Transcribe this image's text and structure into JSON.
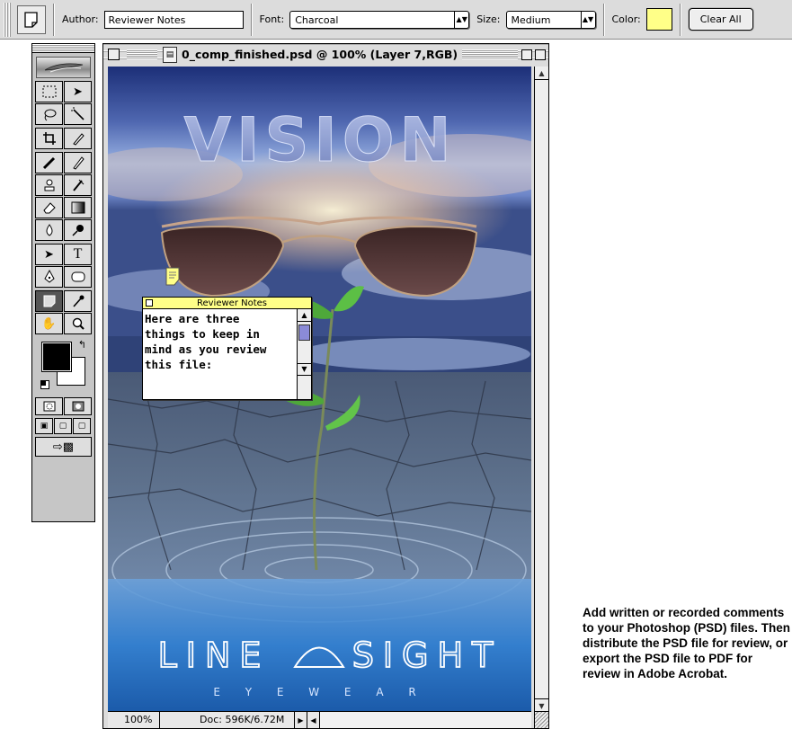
{
  "options_bar": {
    "author_label": "Author:",
    "author_value": "Reviewer Notes",
    "font_label": "Font:",
    "font_value": "Charcoal",
    "size_label": "Size:",
    "size_value": "Medium",
    "color_label": "Color:",
    "note_color": "#ffff88",
    "clear_all_label": "Clear All"
  },
  "document": {
    "title": "0_comp_finished.psd @ 100% (Layer 7,RGB)",
    "zoom": "100%",
    "doc_size": "Doc: 596K/6.72M",
    "artwork": {
      "headline": "VISION",
      "brand": "LINE",
      "brand2": "SIGHT",
      "tagline": "E  Y  E  W  E  A  R"
    }
  },
  "note": {
    "title": "Reviewer Notes",
    "body": "Here are three\nthings to keep in\nmind as you review\nthis file:"
  },
  "caption": "Add written or recorded comments to your Photoshop (PSD) files. Then distribute the PSD file for review, or export the PSD file to PDF for review in Adobe Acrobat.",
  "toolbox": {
    "tools": [
      "marquee-tool",
      "move-tool",
      "lasso-tool",
      "magic-wand-tool",
      "crop-tool",
      "slice-tool",
      "healing-brush-tool",
      "brush-tool",
      "clone-stamp-tool",
      "history-brush-tool",
      "eraser-tool",
      "gradient-tool",
      "blur-tool",
      "dodge-tool",
      "path-selection-tool",
      "type-tool",
      "pen-tool",
      "shape-tool",
      "notes-tool",
      "eyedropper-tool",
      "hand-tool",
      "zoom-tool"
    ]
  }
}
